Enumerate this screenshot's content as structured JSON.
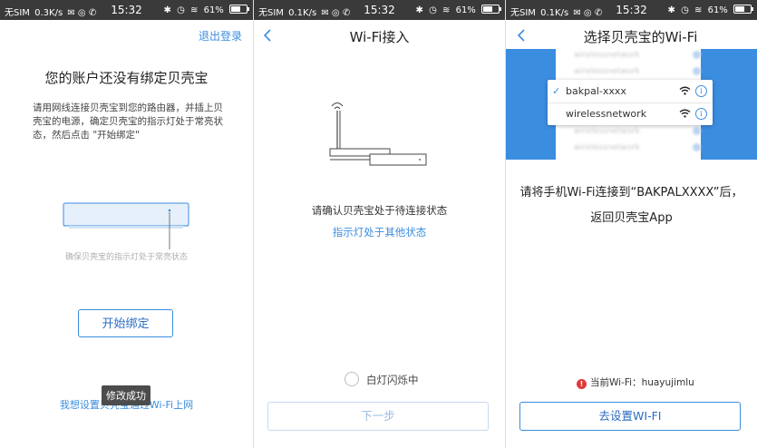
{
  "status": {
    "screen1": {
      "carrier": "无SIM",
      "speed": "0.3K/s",
      "time": "15:32",
      "battery": "61%"
    },
    "screen2": {
      "carrier": "无SIM",
      "speed": "0.1K/s",
      "time": "15:32",
      "battery": "61%"
    },
    "screen3": {
      "carrier": "无SIM",
      "speed": "0.1K/s",
      "time": "15:32",
      "battery": "61%"
    }
  },
  "screen1": {
    "logout": "退出登录",
    "heading": "您的账户还没有绑定贝壳宝",
    "description": "请用网线连接贝壳宝到您的路由器，并插上贝壳宝的电源，确定贝壳宝的指示灯处于常亮状态，然后点击 \"开始绑定\"",
    "router_note": "确保贝壳宝的指示灯处于常亮状态",
    "start_button": "开始绑定",
    "toast": "修改成功",
    "wifi_link": "我想设置贝壳宝通过Wi-Fi上网"
  },
  "screen2": {
    "title": "Wi-Fi接入",
    "confirm_text": "请确认贝壳宝处于待连接状态",
    "other_state_link": "指示灯处于其他状态",
    "radio_label": "白灯闪烁中",
    "next_button": "下一步"
  },
  "screen3": {
    "title": "选择贝壳宝的Wi-Fi",
    "ghost_networks": [
      "wirelessnetwork",
      "wirelessnetwork",
      "wirelessnetwork",
      "wirelessnetwork",
      "wirelessnetwork"
    ],
    "networks": [
      {
        "name": "bakpal-xxxx",
        "selected": true
      },
      {
        "name": "wirelessnetwork",
        "selected": false
      }
    ],
    "instruction_line1": "请将手机Wi-Fi连接到“BAKPALXXXX”后，",
    "instruction_line2": "返回贝壳宝App",
    "current_wifi_label": "当前Wi-Fi：",
    "current_wifi_value": "huayujimlu",
    "goto_button": "去设置WI-FI"
  },
  "colors": {
    "accent": "#3b8de0",
    "statusbar": "#3a3a3a",
    "warning": "#e03a3a"
  }
}
